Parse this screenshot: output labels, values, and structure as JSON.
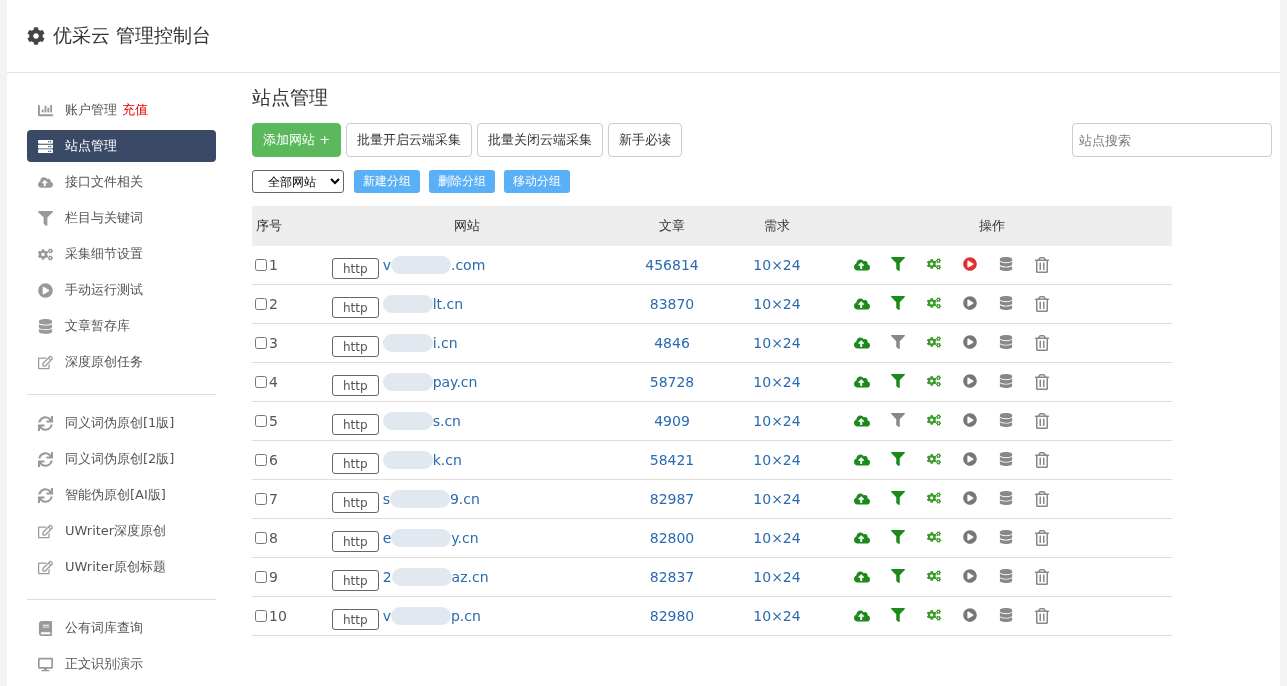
{
  "header": {
    "title": "优采云 管理控制台"
  },
  "sidebar": {
    "groups": [
      {
        "items": [
          {
            "kind": "chart",
            "label": "账户管理",
            "badge": "充值",
            "selected": false
          },
          {
            "kind": "server",
            "label": "站点管理",
            "selected": true
          },
          {
            "kind": "cloud",
            "label": "接口文件相关",
            "selected": false
          },
          {
            "kind": "filter",
            "label": "栏目与关键词",
            "selected": false
          },
          {
            "kind": "cogs",
            "label": "采集细节设置",
            "selected": false
          },
          {
            "kind": "play",
            "label": "手动运行测试",
            "selected": false
          },
          {
            "kind": "database",
            "label": "文章暂存库",
            "selected": false
          },
          {
            "kind": "edit",
            "label": "深度原创任务",
            "selected": false
          }
        ]
      },
      {
        "items": [
          {
            "kind": "sync",
            "label": "同义词伪原创[1版]",
            "selected": false
          },
          {
            "kind": "sync",
            "label": "同义词伪原创[2版]",
            "selected": false
          },
          {
            "kind": "sync",
            "label": "智能伪原创[AI版]",
            "selected": false
          },
          {
            "kind": "edit",
            "label": "UWriter深度原创",
            "selected": false
          },
          {
            "kind": "edit",
            "label": "UWriter原创标题",
            "selected": false
          }
        ]
      },
      {
        "items": [
          {
            "kind": "book",
            "label": "公有词库查询",
            "selected": false
          },
          {
            "kind": "desktop",
            "label": "正文识别演示",
            "selected": false
          }
        ]
      }
    ]
  },
  "main": {
    "title": "站点管理",
    "toolbar": [
      {
        "kind": "primary",
        "label": "添加网站 +"
      },
      {
        "kind": "default",
        "label": "批量开启云端采集"
      },
      {
        "kind": "default",
        "label": "批量关闭云端采集"
      },
      {
        "kind": "default",
        "label": "新手必读"
      }
    ],
    "search": {
      "placeholder": "站点搜索"
    },
    "group_select": {
      "value": "全部网站"
    },
    "group_buttons": [
      "新建分组",
      "删除分组",
      "移动分组"
    ],
    "table": {
      "columns": [
        "序号",
        "网站",
        "文章",
        "需求",
        "操作"
      ],
      "rows": [
        {
          "checked": false,
          "index": "1",
          "scheme": "http",
          "domain_prefix": "v",
          "domain_suffix": ".com",
          "articles": "456814",
          "demand": "10×24",
          "filter_on": true,
          "running": true
        },
        {
          "checked": false,
          "index": "2",
          "scheme": "http",
          "domain_prefix": "",
          "domain_suffix": "lt.cn",
          "articles": "83870",
          "demand": "10×24",
          "filter_on": true,
          "running": false
        },
        {
          "checked": false,
          "index": "3",
          "scheme": "http",
          "domain_prefix": "",
          "domain_suffix": "i.cn",
          "articles": "4846",
          "demand": "10×24",
          "filter_on": false,
          "running": false
        },
        {
          "checked": false,
          "index": "4",
          "scheme": "http",
          "domain_prefix": "",
          "domain_suffix": "pay.cn",
          "articles": "58728",
          "demand": "10×24",
          "filter_on": true,
          "running": false
        },
        {
          "checked": false,
          "index": "5",
          "scheme": "http",
          "domain_prefix": "",
          "domain_suffix": "s.cn",
          "articles": "4909",
          "demand": "10×24",
          "filter_on": false,
          "running": false
        },
        {
          "checked": false,
          "index": "6",
          "scheme": "http",
          "domain_prefix": "",
          "domain_suffix": "k.cn",
          "articles": "58421",
          "demand": "10×24",
          "filter_on": true,
          "running": false
        },
        {
          "checked": false,
          "index": "7",
          "scheme": "http",
          "domain_prefix": "s",
          "domain_suffix": "9.cn",
          "articles": "82987",
          "demand": "10×24",
          "filter_on": true,
          "running": false
        },
        {
          "checked": false,
          "index": "8",
          "scheme": "http",
          "domain_prefix": "e",
          "domain_suffix": "y.cn",
          "articles": "82800",
          "demand": "10×24",
          "filter_on": true,
          "running": false
        },
        {
          "checked": false,
          "index": "9",
          "scheme": "http",
          "domain_prefix": "2",
          "domain_suffix": "az.cn",
          "articles": "82837",
          "demand": "10×24",
          "filter_on": true,
          "running": false
        },
        {
          "checked": false,
          "index": "10",
          "scheme": "http",
          "domain_prefix": "v",
          "domain_suffix": "p.cn",
          "articles": "82980",
          "demand": "10×24",
          "filter_on": true,
          "running": false
        }
      ]
    }
  }
}
